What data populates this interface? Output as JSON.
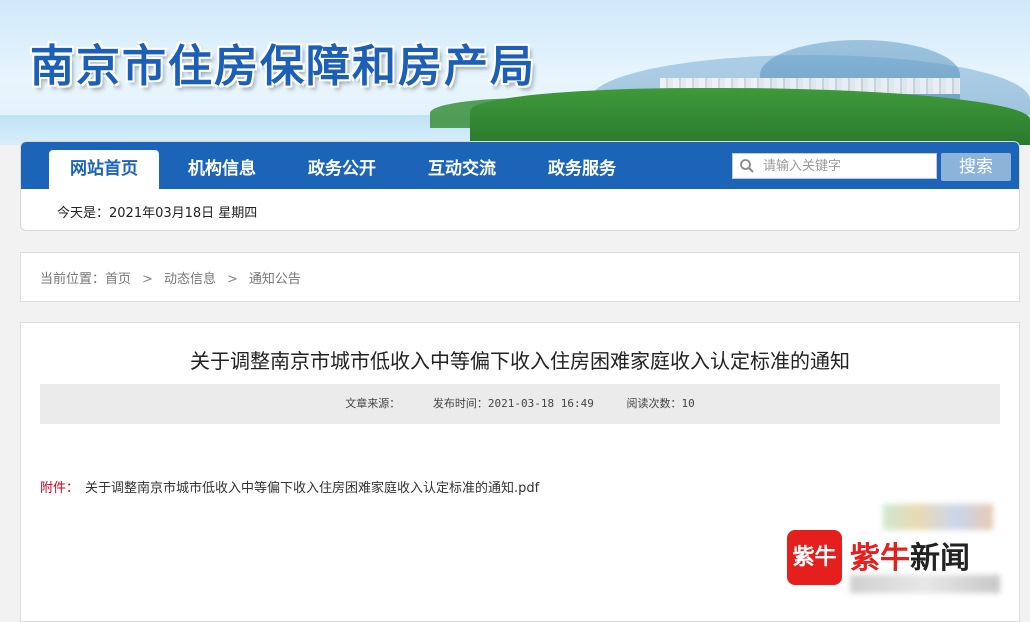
{
  "header": {
    "site_title": "南京市住房保障和房产局"
  },
  "nav": {
    "items": [
      {
        "label": "网站首页",
        "active": true
      },
      {
        "label": "机构信息",
        "active": false
      },
      {
        "label": "政务公开",
        "active": false
      },
      {
        "label": "互动交流",
        "active": false
      },
      {
        "label": "政务服务",
        "active": false
      }
    ],
    "search_placeholder": "请输入关键字",
    "search_button": "搜索",
    "date_text": "今天是：2021年03月18日 星期四"
  },
  "breadcrumb": {
    "prefix": "当前位置：",
    "items": [
      "首页",
      "动态信息",
      "通知公告"
    ],
    "separator": ">"
  },
  "article": {
    "title": "关于调整南京市城市低收入中等偏下收入住房困难家庭收入认定标准的通知",
    "source_label": "文章来源：",
    "publish_time": "发布时间：2021-03-18 16:49",
    "read_count": "阅读次数：10",
    "attachment_label": "附件：",
    "attachment_file": "关于调整南京市城市低收入中等偏下收入住房困难家庭收入认定标准的通知.pdf"
  },
  "watermark": {
    "logo_text": "紫牛",
    "brand_part1": "紫牛",
    "brand_part2": "新闻"
  },
  "colors": {
    "nav_blue": "#1c64b8",
    "attachment_red": "#d0021b",
    "search_button": "#8cb3d9"
  }
}
